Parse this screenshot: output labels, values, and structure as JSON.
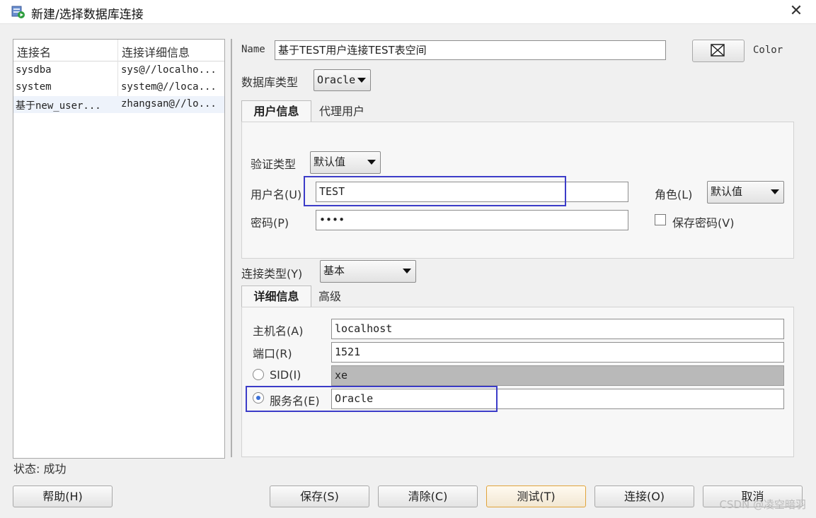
{
  "window": {
    "title": "新建/选择数据库连接",
    "close_glyph": "✕"
  },
  "conn_list": {
    "headers": [
      "连接名",
      "连接详细信息"
    ],
    "rows": [
      {
        "name": "sysdba",
        "detail": "sys@//localho..."
      },
      {
        "name": "system",
        "detail": "system@//loca..."
      },
      {
        "name": "基于new_user...",
        "detail": "zhangsan@//lo..."
      }
    ]
  },
  "status": {
    "text": "状态: 成功"
  },
  "name_field": {
    "label": "Name",
    "value": "基于TEST用户连接TEST表空间"
  },
  "color_button": {
    "label": "Color"
  },
  "db_type": {
    "label": "数据库类型",
    "value": "Oracle"
  },
  "user_tabs": {
    "active": "用户信息",
    "other": "代理用户"
  },
  "auth": {
    "type_label": "验证类型",
    "type_value": "默认值",
    "username_label": "用户名(U)",
    "username_value": "TEST",
    "password_label": "密码(P)",
    "password_value": "••••",
    "role_label": "角色(L)",
    "role_value": "默认值",
    "save_pw_label": "保存密码(V)"
  },
  "conn_type": {
    "label": "连接类型(Y)",
    "value": "基本"
  },
  "detail_tabs": {
    "active": "详细信息",
    "other": "高级"
  },
  "details": {
    "host_label": "主机名(A)",
    "host_value": "localhost",
    "port_label": "端口(R)",
    "port_value": "1521",
    "sid_label": "SID(I)",
    "sid_value": "xe",
    "service_label": "服务名(E)",
    "service_value": "Oracle"
  },
  "buttons": {
    "help": "帮助(H)",
    "save": "保存(S)",
    "clear": "清除(C)",
    "test": "测试(T)",
    "connect": "连接(O)",
    "cancel": "取消"
  },
  "watermark": "CSDN @凌空暗羽",
  "colors": {
    "highlight": "#3c3cc8",
    "focus_border": "#e0a33a"
  }
}
